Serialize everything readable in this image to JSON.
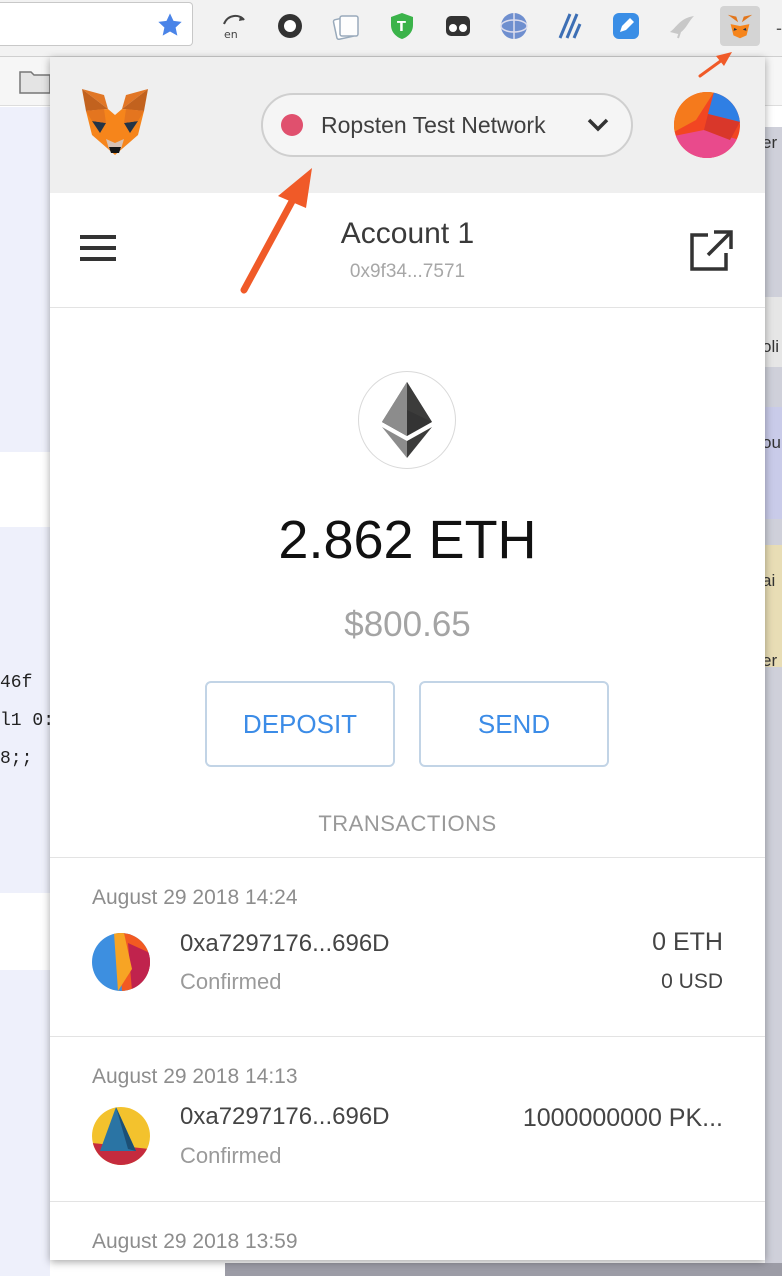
{
  "browser": {
    "extensions": [
      {
        "name": "translate-extension-icon"
      },
      {
        "name": "circle-extension-icon"
      },
      {
        "name": "notes-extension-icon"
      },
      {
        "name": "shield-extension-icon"
      },
      {
        "name": "glasses-extension-icon"
      },
      {
        "name": "globe-extension-icon"
      },
      {
        "name": "lambda-extension-icon"
      },
      {
        "name": "pen-extension-icon"
      },
      {
        "name": "bird-extension-icon"
      },
      {
        "name": "metamask-extension-icon"
      }
    ],
    "background_code_lines": [
      "46f",
      "l1 0:",
      "8;;"
    ],
    "background_right_text": [
      "er",
      "oli",
      "ou",
      "ai",
      "er"
    ]
  },
  "metamask": {
    "network": {
      "label": "Ropsten Test Network",
      "dot_color": "#e0506e"
    },
    "account": {
      "name": "Account 1",
      "address": "0x9f34...7571"
    },
    "balance": {
      "eth": "2.862 ETH",
      "usd": "$800.65"
    },
    "buttons": {
      "deposit": "DEPOSIT",
      "send": "SEND"
    },
    "transactions_heading": "TRANSACTIONS",
    "transactions": [
      {
        "date": "August 29 2018 14:24",
        "address": "0xa7297176...696D",
        "status": "Confirmed",
        "amount": "0 ETH",
        "fiat": "0 USD"
      },
      {
        "date": "August 29 2018 14:13",
        "address": "0xa7297176...696D",
        "status": "Confirmed",
        "amount": "1000000000 PK..."
      },
      {
        "date": "August 29 2018 13:59"
      }
    ],
    "colors": {
      "accent_blue": "#3c8ce7",
      "annotation_arrow": "#f05a28"
    }
  }
}
